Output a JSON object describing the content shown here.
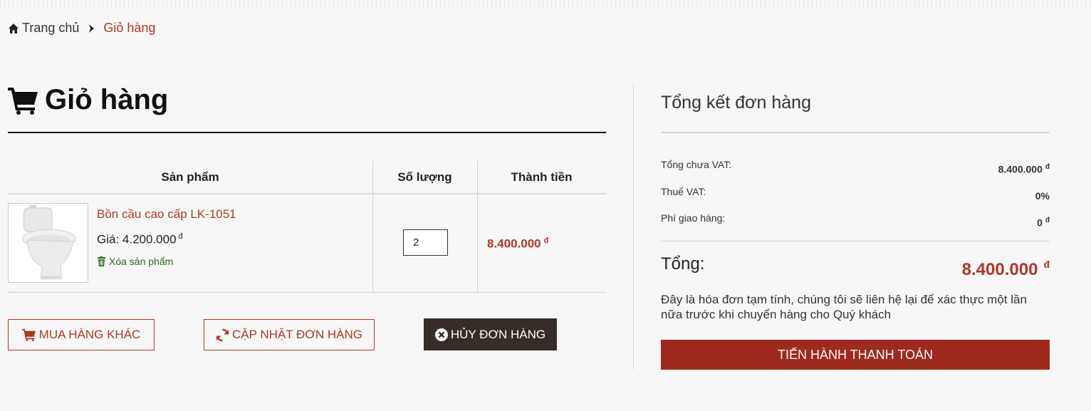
{
  "breadcrumb": {
    "home": "Trang chủ",
    "current": "Giỏ hàng"
  },
  "cart": {
    "title": "Giỏ hàng",
    "columns": {
      "product": "Sản phẩm",
      "quantity": "Số lượng",
      "total": "Thành tiền"
    },
    "item": {
      "name": "Bồn cầu cao cấp LK-1051",
      "price": "Giá: 4.200.000",
      "currency": "đ",
      "remove_label": "Xóa sản phẩm",
      "quantity": "2",
      "line_total": "8.400.000"
    },
    "buttons": {
      "continue": "MUA HÀNG KHÁC",
      "update": "CẬP NHẬT ĐƠN HÀNG",
      "cancel": "HỦY ĐƠN HÀNG"
    }
  },
  "summary": {
    "title": "Tổng kết đơn hàng",
    "subtotal_label": "Tổng chưa VAT:",
    "subtotal_value": "8.400.000",
    "vat_label": "Thuế VAT:",
    "vat_value": "0%",
    "shipping_label": "Phí giao hàng:",
    "shipping_value": "0",
    "total_label": "Tổng:",
    "total_value": "8.400.000",
    "currency": "đ",
    "note": "Đây là hóa đơn tạm tính, chúng tôi sẽ liên hệ lại để xác thực một lần nữa trước khi chuyển hàng cho Quý khách",
    "checkout": "TIẾN HÀNH THANH TOÁN"
  },
  "colors": {
    "accent": "#b03626",
    "dark_button": "#362d28",
    "checkout": "#9e2a1d"
  }
}
